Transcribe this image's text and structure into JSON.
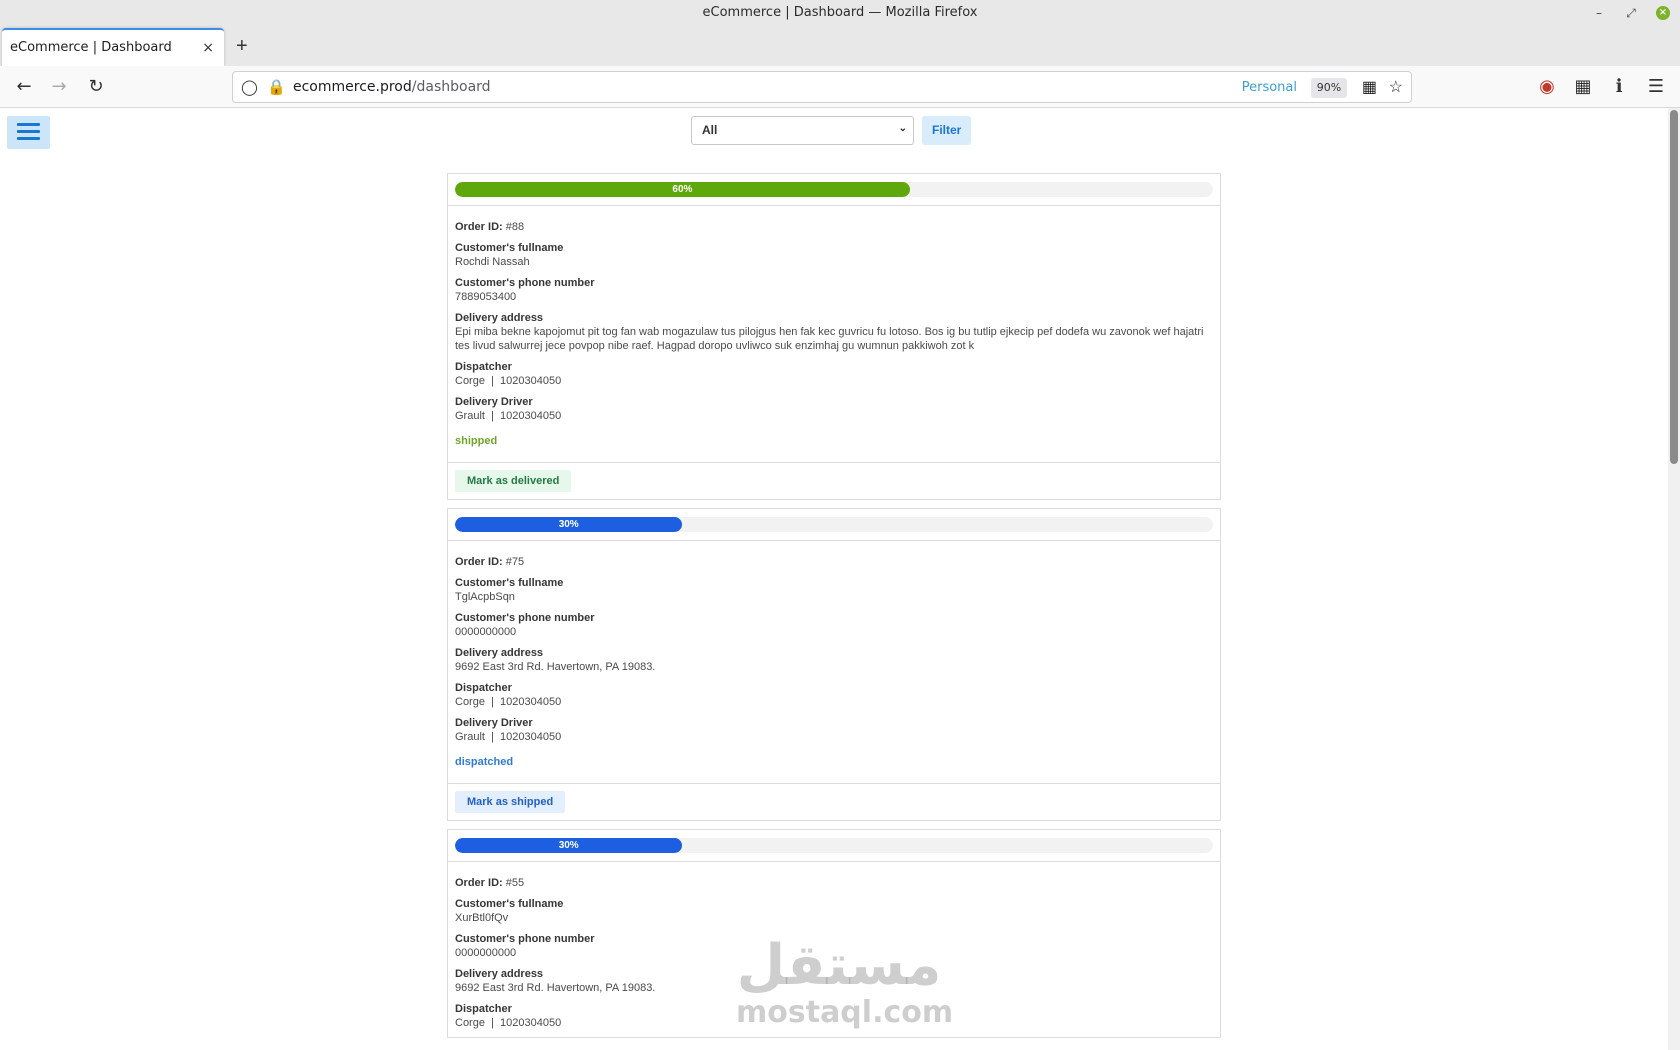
{
  "window": {
    "title": "eCommerce | Dashboard — Mozilla Firefox",
    "min_icon": "minimize-icon",
    "max_icon": "maximize-icon",
    "close_glyph": "×"
  },
  "browser": {
    "tab_title": "eCommerce | Dashboard",
    "tab_close": "×",
    "new_tab": "+",
    "url_host": "ecommerce.prod",
    "url_path": "/dashboard",
    "profile_label": "Personal",
    "zoom_level": "90%"
  },
  "toolbar": {
    "filter_select_value": "All",
    "filter_button_label": "Filter"
  },
  "orders": [
    {
      "progress_label": "60%",
      "progress": 60,
      "progress_color": "#5fa80b",
      "order_id_label": "Order ID:",
      "order_id": "#88",
      "fullname_label": "Customer's fullname",
      "fullname": "Rochdi Nassah",
      "phone_label": "Customer's phone number",
      "phone": "7889053400",
      "address_label": "Delivery address",
      "address": "Epi miba bekne kapojomut pit tog fan wab mogazulaw tus pilojgus hen fak kec guvricu fu lotoso. Bos ig bu tutlip ejkecip pef dodefa wu zavonok wef hajatri tes livud salwurrej jece povpop nibe raef. Hagpad doropo uvliwco suk enzimhaj gu wumnun pakkiwoh zot k",
      "dispatcher_label": "Dispatcher",
      "dispatcher": "Corge  |  1020304050",
      "driver_label": "Delivery Driver",
      "driver": "Grault  |  1020304050",
      "status": "shipped",
      "status_color": "#6fa52a",
      "action_label": "Mark as delivered"
    },
    {
      "progress_label": "30%",
      "progress": 30,
      "progress_color": "#1d5fe0",
      "order_id_label": "Order ID:",
      "order_id": "#75",
      "fullname_label": "Customer's fullname",
      "fullname": "TglAcpbSqn",
      "phone_label": "Customer's phone number",
      "phone": "0000000000",
      "address_label": "Delivery address",
      "address": "9692 East 3rd Rd. Havertown, PA 19083.",
      "dispatcher_label": "Dispatcher",
      "dispatcher": "Corge  |  1020304050",
      "driver_label": "Delivery Driver",
      "driver": "Grault  |  1020304050",
      "status": "dispatched",
      "status_color": "#2f7ad6",
      "action_label": "Mark as shipped"
    },
    {
      "progress_label": "30%",
      "progress": 30,
      "progress_color": "#1d5fe0",
      "order_id_label": "Order ID:",
      "order_id": "#55",
      "fullname_label": "Customer's fullname",
      "fullname": "XurBtl0fQv",
      "phone_label": "Customer's phone number",
      "phone": "0000000000",
      "address_label": "Delivery address",
      "address": "9692 East 3rd Rd. Havertown, PA 19083.",
      "dispatcher_label": "Dispatcher",
      "dispatcher": "Corge  |  1020304050"
    }
  ],
  "watermark": {
    "arabic": "مستقل",
    "latin": "mostaql.com"
  }
}
